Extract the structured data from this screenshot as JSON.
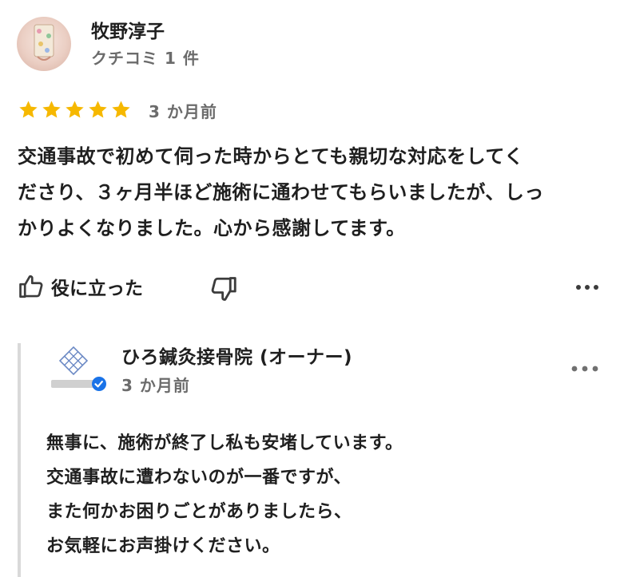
{
  "review": {
    "reviewer_name": "牧野淳子",
    "reviewer_meta": "クチコミ 1 件",
    "rating": 5,
    "star_color": "#F6B800",
    "date": "3 か月前",
    "text": "交通事故で初めて伺った時からとても親切な対応をしてく\nださり、３ヶ月半ほど施術に通わせてもらいましたが、しっ\nかりよくなりました。心から感謝してます。"
  },
  "actions": {
    "helpful_label": "役に立った",
    "helpful_icon": "thumbs-up-icon",
    "unhelpful_icon": "thumbs-down-icon",
    "more_icon": "more-options-icon"
  },
  "owner_reply": {
    "owner_name": "ひろ鍼灸接骨院 (オーナー)",
    "date": "3 か月前",
    "verified_color": "#1A73E8",
    "text": "無事に、施術が終了し私も安堵しています。\n交通事故に遭わないのが一番ですが、\nまた何かお困りごとがありましたら、\nお気軽にお声掛けください。"
  }
}
